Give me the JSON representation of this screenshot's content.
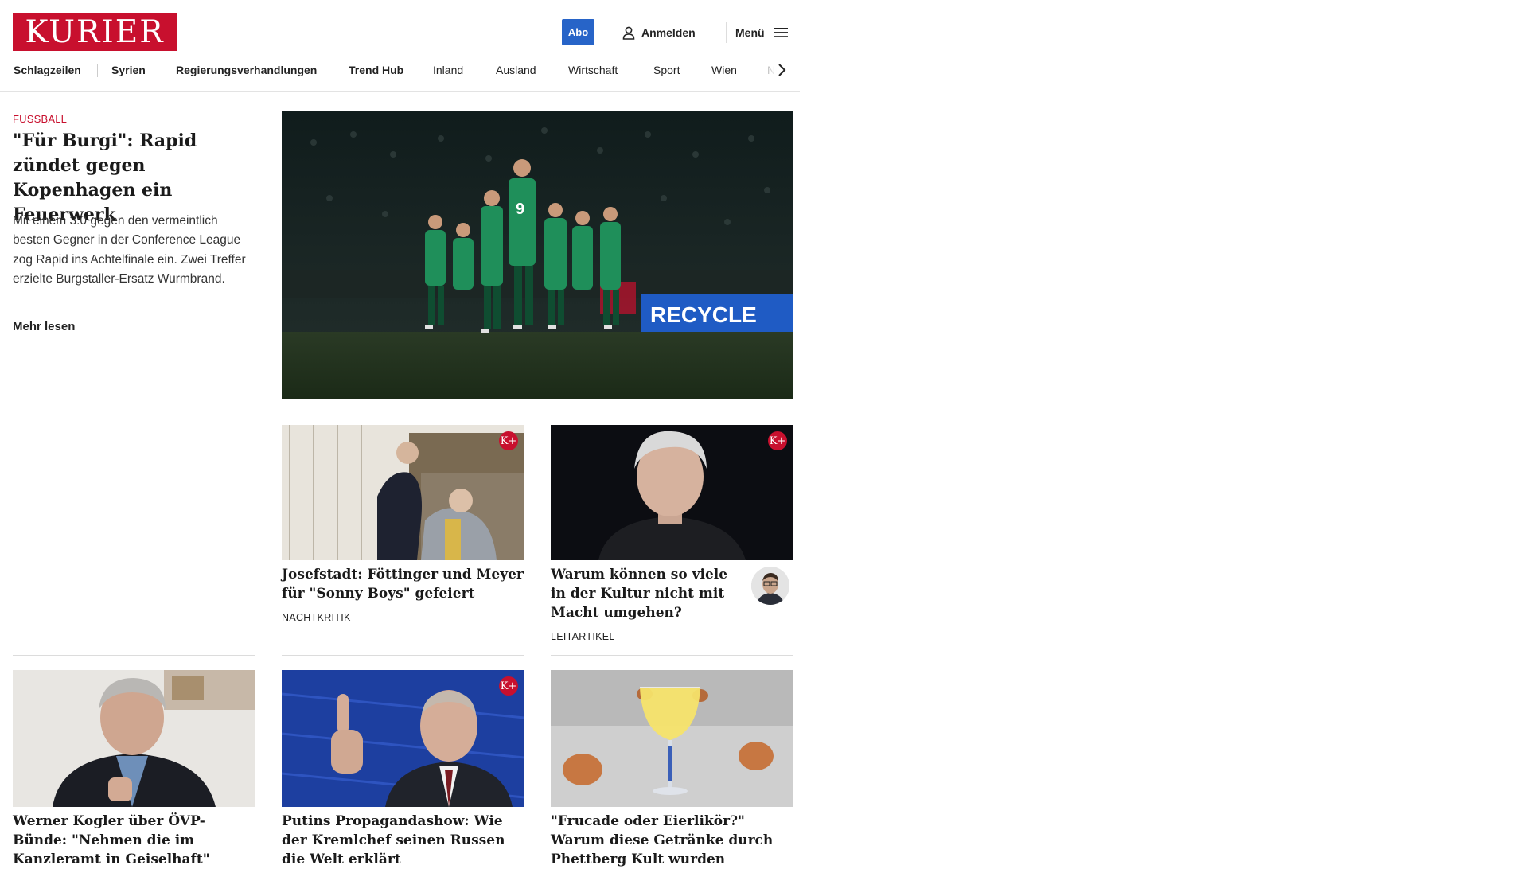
{
  "header": {
    "logo_text": "KURIER",
    "abo_label": "Abo",
    "login_label": "Anmelden",
    "menu_label": "Menü"
  },
  "nav": {
    "items": [
      {
        "label": "Schlagzeilen"
      },
      {
        "label": "Syrien"
      },
      {
        "label": "Regierungsverhandlungen"
      },
      {
        "label": "Trend Hub"
      },
      {
        "label": "Inland"
      },
      {
        "label": "Ausland"
      },
      {
        "label": "Wirtschaft"
      },
      {
        "label": "Sport"
      },
      {
        "label": "Wien"
      },
      {
        "label": "NÖ"
      }
    ]
  },
  "lead": {
    "kicker": "FUSSBALL",
    "title": "\"Für Burgi\": Rapid zündet gegen Kopenhagen ein Feuerwerk",
    "teaser": "Mit einem 3:0 gegen den vermeintlich besten Gegner in der Conference League zog Rapid ins Achtelfinale ein. Zwei Treffer erzielte Burgstaller-Ersatz Wurmbrand.",
    "more_label": "Mehr lesen",
    "image_text": "RECYCLE"
  },
  "cards": [
    {
      "title": "Josefstadt: Föttinger und Meyer für \"Sonny Boys\" gefeiert",
      "tag": "NACHTKRITIK",
      "plus": "K+"
    },
    {
      "title": "Warum können so viele in der Kultur nicht mit Macht umgehen?",
      "tag": "LEITARTIKEL",
      "plus": "K+"
    },
    {
      "title": "Werner Kogler über ÖVP-Bünde: \"Nehmen die im Kanzleramt in Geiselhaft\""
    },
    {
      "title": "Putins Propagandashow: Wie der Kremlchef seinen Russen die Welt erklärt",
      "plus": "K+"
    },
    {
      "title": "\"Frucade oder Eierlikör?\" Warum diese Getränke durch Phettberg Kult wurden"
    }
  ],
  "colors": {
    "brand_red": "#c8102e",
    "abo_blue": "#2764c8"
  }
}
